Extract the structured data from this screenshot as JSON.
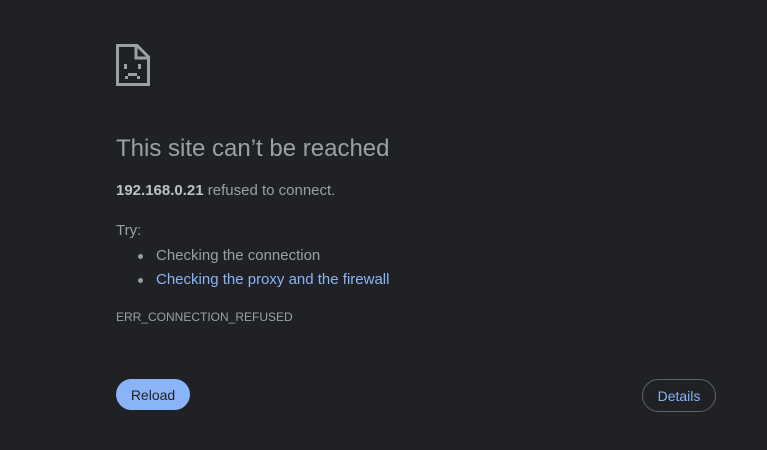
{
  "page": {
    "icon": "sad-document-icon",
    "title": "This site can’t be reached",
    "host": "192.168.0.21",
    "message_suffix": " refused to connect.",
    "try_label": "Try:",
    "suggestions": [
      {
        "text": "Checking the connection",
        "is_link": false
      },
      {
        "text": "Checking the proxy and the firewall",
        "is_link": true
      }
    ],
    "error_code": "ERR_CONNECTION_REFUSED"
  },
  "buttons": {
    "reload_label": "Reload",
    "details_label": "Details"
  },
  "colors": {
    "background": "#202124",
    "text": "#9aa0a6",
    "link": "#8ab4f8",
    "primary_button": "#8ab4f8"
  }
}
